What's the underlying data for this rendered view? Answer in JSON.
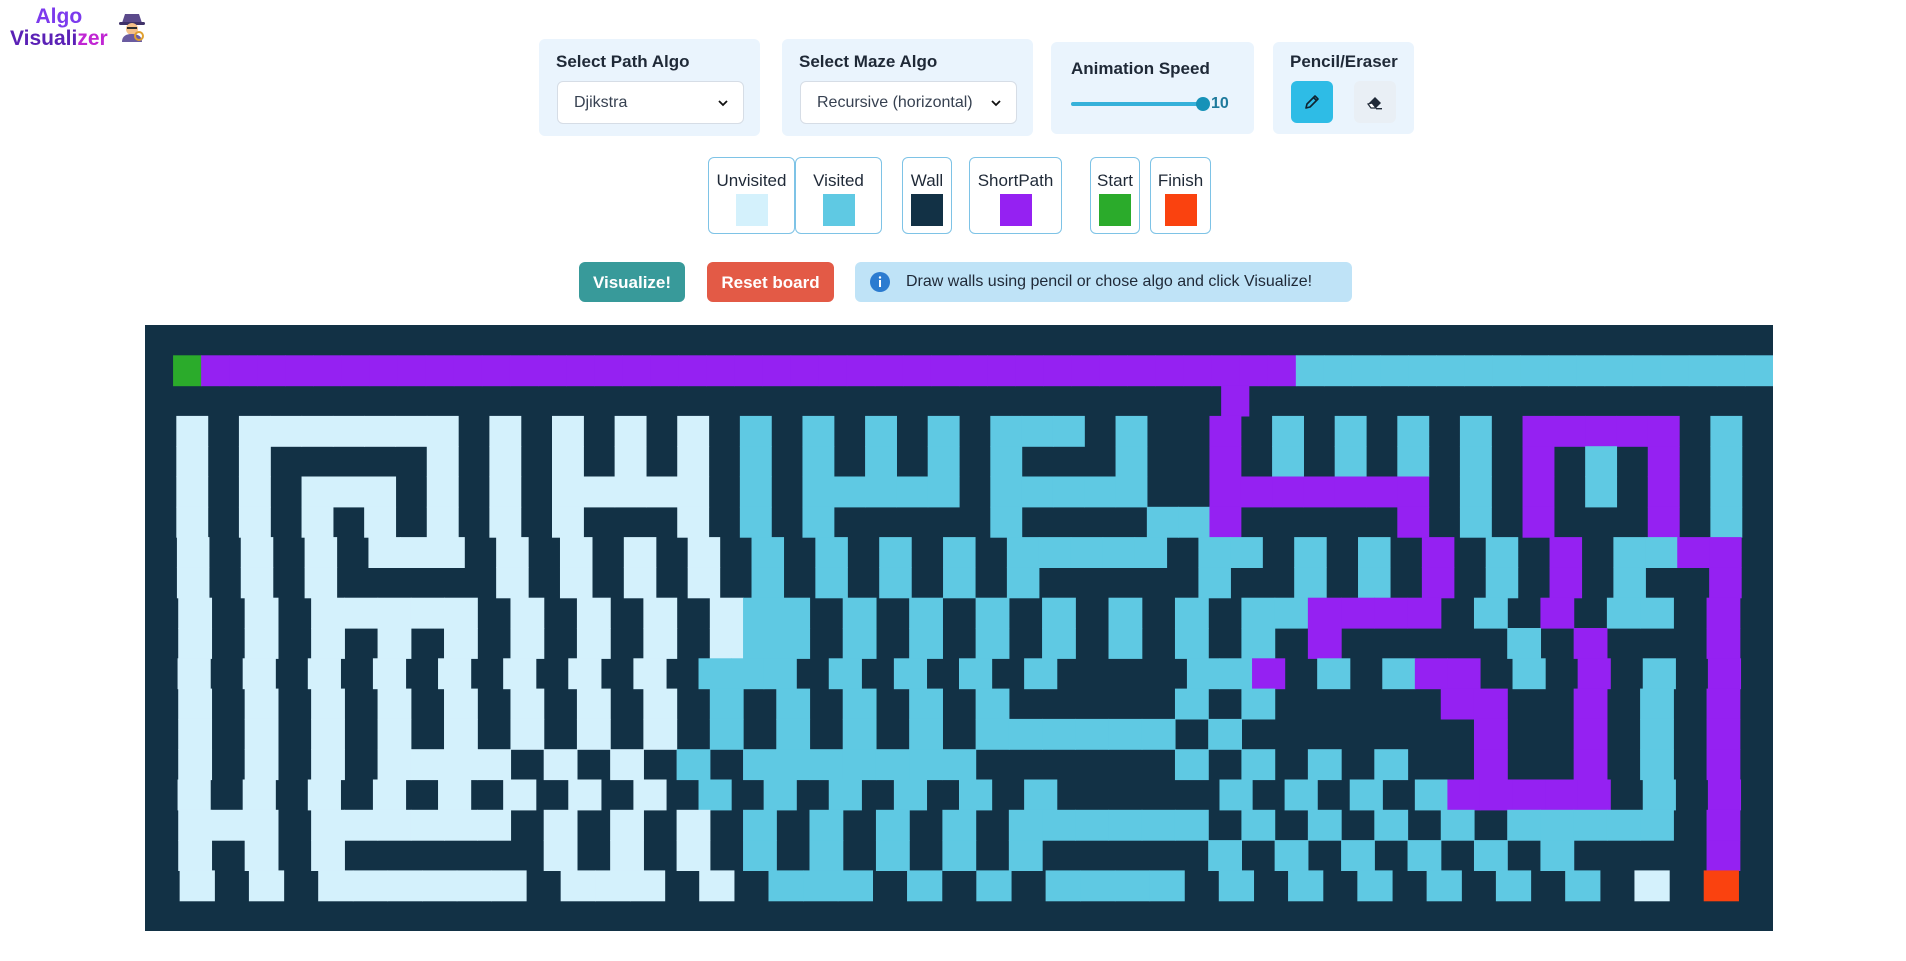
{
  "app": {
    "logo_line1": "Algo",
    "logo_line2_a": "Visuali",
    "logo_line2_b": "zer"
  },
  "controls": {
    "path_algo": {
      "label": "Select Path Algo",
      "value": "Djikstra"
    },
    "maze_algo": {
      "label": "Select Maze Algo",
      "value": "Recursive (horizontal)"
    },
    "speed": {
      "label": "Animation Speed",
      "value": "10",
      "level": 1.0
    },
    "tools": {
      "label": "Pencil/Eraser",
      "pencil_active": true
    }
  },
  "legend": [
    {
      "label": "Unvisited",
      "color": "#d4f1fc"
    },
    {
      "label": "Visited",
      "color": "#5fc9e3"
    },
    {
      "label": "Wall",
      "color": "#123145"
    },
    {
      "label": "ShortPath",
      "color": "#9521f2"
    },
    {
      "label": "Start",
      "color": "#2bab2b"
    },
    {
      "label": "Finish",
      "color": "#fa420f"
    }
  ],
  "actions": {
    "visualize_label": "Visualize!",
    "reset_label": "Reset board",
    "info_text": "Draw walls using pencil or chose algo and click Visualize!"
  },
  "grid": {
    "key": {
      "W": "wall",
      "U": "unvisited",
      "V": "visited",
      "P": "shortest-path",
      "S": "start",
      "F": "finish"
    },
    "rows": [
      "WWWWWWWWWWWWWWWWWWWWWWWWWWWWWWWWWWWWWWWWWWWWWWWWWWWWW",
      "WSPPPPPPPPPPPPPPPPPPPPPPPPPPPPPPPPPPPPPPPVVVVVVVVVVVVVVVVV",
      "WWWWWWWWWWWWWWWWWWWWWWWWWWWWWWWWWWWWWWWPWWWWWWWWWWWWWWWWWWW",
      "WUWUUUUUUUWUWUWUWUWVWVWVWVWVVVWVWWPWVWVWVWVWPPPPPWVW",
      "WUWUWWWWWUWUWUWUWUWVWVWVWVWVWWWVWWPWVWVWVWVWPWVWPWVW",
      "WUWUWUUUWUWUWUUUUUWVWVVVVVWVVVVVWWPPPPPPPWVWPWVWPWVW",
      "WUWUWUWUWUWUWUWWWUWVWVWWWWWVWWWWVVPWWWWWPWVWPWWWPWVW",
      "WUWUWUWUUUWUWUWUWUWVWVWVWVWVVVVVWVVWVWVWPWVWPWVVPPW",
      "WUWUWUWWWWWUWUWUWUWVWVWVWVWVWWWWWVWWVWVWPWVWPWVWWPW",
      "WUWUWUUUUUWUWUWUWUVVWVWVWVWVWVWVWVVPPPPWVWPWVVWPW",
      "WUWUWUWUWUWUWUWUWUVVWVWVWVWVWVWVWVWPWWWWWVWPWWWPW",
      "WUWUWUWUWUWUWUWUWVVVWVWVWVWVWWWWVVPWVWVPPWVWPWVWPW",
      "WUWUWUWUWUWUWUWUWVWVWVWVWVWWWWWVWVWWWWWPPWWPWVWPW",
      "WUWUWUWUWUWUWUWUWVWVWVWVWVVVVVVWVWWWWWWWPWWPWVWPW",
      "WUWUWUWUUUUWUWUWVWVVVVVVVWWWWWWVWVWVWVWWPWWPWVWPW",
      "WUWUWUWUWUWUWUWUWVWVWVWVWVWVWWWWWVWVWVWVPPPPPWVWPW",
      "WUUUWUUUUUUWUWUWUWVWVWVWVWVVVVVVWVWVWVWVWVVVVVWPW",
      "WUWUWUWWWWWWUWUWUWVWVWVWVWVWWWWWVWVWVWVWVWVWWWWPW",
      "WUWUWUUUUUUWUUUWUWVVVWVWVWVVVVWVWVWVWVWVWVWUWFW",
      "WWWWWWWWWWWWWWWWWWWWWWWWWWWWWWWWWWWWWWWWWWWWWWWWWWWW"
    ]
  }
}
